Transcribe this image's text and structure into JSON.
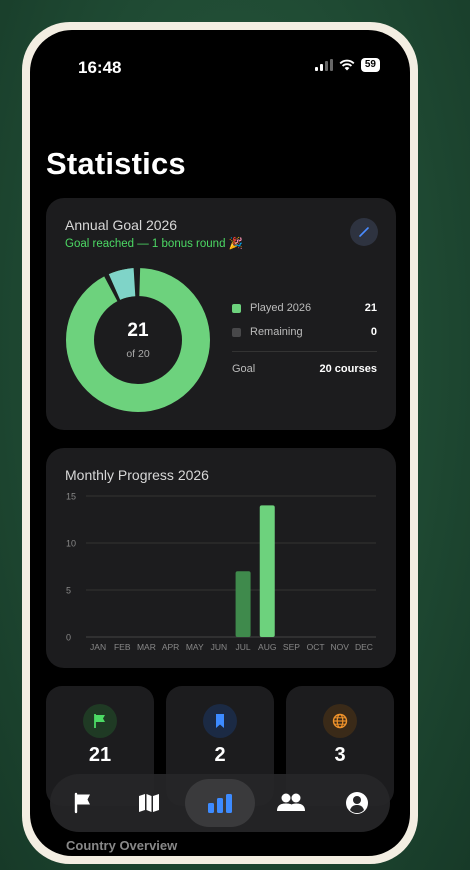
{
  "status": {
    "time": "16:48",
    "battery": "59"
  },
  "page_title": "Statistics",
  "goal": {
    "title": "Annual Goal 2026",
    "subtitle": "Goal reached — 1 bonus round 🎉",
    "played": 21,
    "target": 20,
    "center_value": "21",
    "center_label": "of 20",
    "legend": [
      {
        "label": "Played 2026",
        "value": "21",
        "color": "#6dd27d"
      },
      {
        "label": "Remaining",
        "value": "0",
        "color": "#48484a"
      }
    ],
    "goal_label": "Goal",
    "goal_value": "20 courses",
    "ring_color": "#6dd27d",
    "bonus_color": "#7fd4c8"
  },
  "monthly": {
    "title": "Monthly Progress 2026"
  },
  "chart_data": {
    "type": "bar",
    "title": "Monthly Progress 2026",
    "categories": [
      "JAN",
      "FEB",
      "MAR",
      "APR",
      "MAY",
      "JUN",
      "JUL",
      "AUG",
      "SEP",
      "OCT",
      "NOV",
      "DEC"
    ],
    "values": [
      0,
      0,
      0,
      0,
      0,
      0,
      7,
      14,
      0,
      0,
      0,
      0
    ],
    "ylim": [
      0,
      15
    ],
    "yticks": [
      0,
      5,
      10,
      15
    ],
    "grid": true,
    "colors": {
      "past": "#3f8a4c",
      "current": "#6dd27d"
    },
    "current_index": 7
  },
  "stats": [
    {
      "value": "21",
      "icon": "flag-icon",
      "color": "#4cd964",
      "bg": "#1f3a24"
    },
    {
      "value": "2",
      "icon": "bookmark-icon",
      "color": "#3d8bff",
      "bg": "#1b2a44"
    },
    {
      "value": "3",
      "icon": "globe-icon",
      "color": "#f0932b",
      "bg": "#3a2a18"
    }
  ],
  "country_title": "Country Overview",
  "tabs": [
    {
      "icon": "flag-icon",
      "active": false
    },
    {
      "icon": "map-icon",
      "active": false
    },
    {
      "icon": "statistics-icon",
      "active": true
    },
    {
      "icon": "friends-icon",
      "active": false
    },
    {
      "icon": "profile-icon",
      "active": false
    }
  ]
}
